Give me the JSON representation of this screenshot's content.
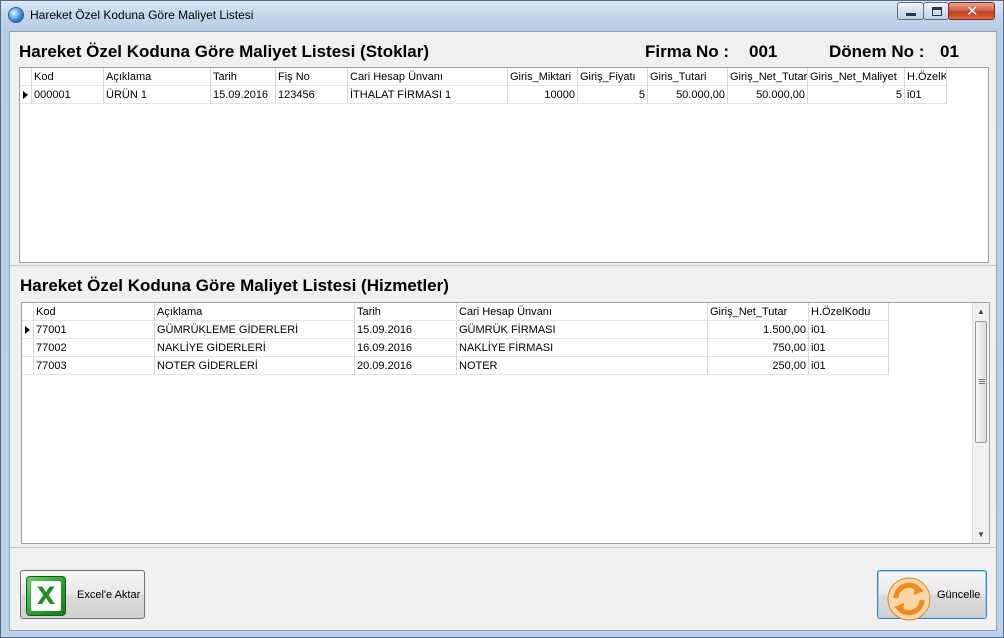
{
  "window": {
    "title": "Hareket Özel Koduna Göre Maliyet Listesi"
  },
  "stok": {
    "heading": "Hareket Özel Koduna Göre Maliyet Listesi (Stoklar)",
    "firma_label": "Firma No :",
    "firma_value": "001",
    "donem_label": "Dönem No :",
    "donem_value": "01",
    "columns": [
      "Kod",
      "Açıklama",
      "Tarih",
      "Fiş No",
      "Cari Hesap Ünvanı",
      "Giris_Miktari",
      "Giriş_Fiyatı",
      "Giris_Tutari",
      "Giriş_Net_Tutar",
      "Giris_Net_Maliyet",
      "H.ÖzelKodu"
    ],
    "rows": [
      [
        "000001",
        "ÜRÜN 1",
        "15.09.2016",
        "123456",
        "İTHALAT  FİRMASI 1",
        "10000",
        "5",
        "50.000,00",
        "50.000,00",
        "5",
        "i01"
      ]
    ]
  },
  "hizmet": {
    "heading": "Hareket Özel Koduna Göre Maliyet Listesi (Hizmetler)",
    "columns": [
      "Kod",
      "Açıklama",
      "Tarih",
      "Cari Hesap Ünvanı",
      "Giriş_Net_Tutar",
      "H.ÖzelKodu"
    ],
    "rows": [
      [
        "77001",
        "GÜMRÜKLEME GİDERLERİ",
        "15.09.2016",
        "GÜMRÜK FİRMASI",
        "1.500,00",
        "i01"
      ],
      [
        "77002",
        "NAKLİYE GİDERLERİ",
        "16.09.2016",
        "NAKLİYE FİRMASI",
        "750,00",
        "i01"
      ],
      [
        "77003",
        "NOTER GİDERLERİ",
        "20.09.2016",
        "NOTER",
        "250,00",
        "i01"
      ]
    ]
  },
  "buttons": {
    "excel": "Excel'e Aktar",
    "refresh": "Güncelle"
  },
  "icons": {
    "app": "app-globe-icon",
    "excel": "excel-icon",
    "refresh": "refresh-icon"
  },
  "colors": {
    "title_bar": "#c3d5ea",
    "close_button": "#c13e22",
    "excel_green": "#2aa12f",
    "refresh_orange": "#f08a1c"
  }
}
